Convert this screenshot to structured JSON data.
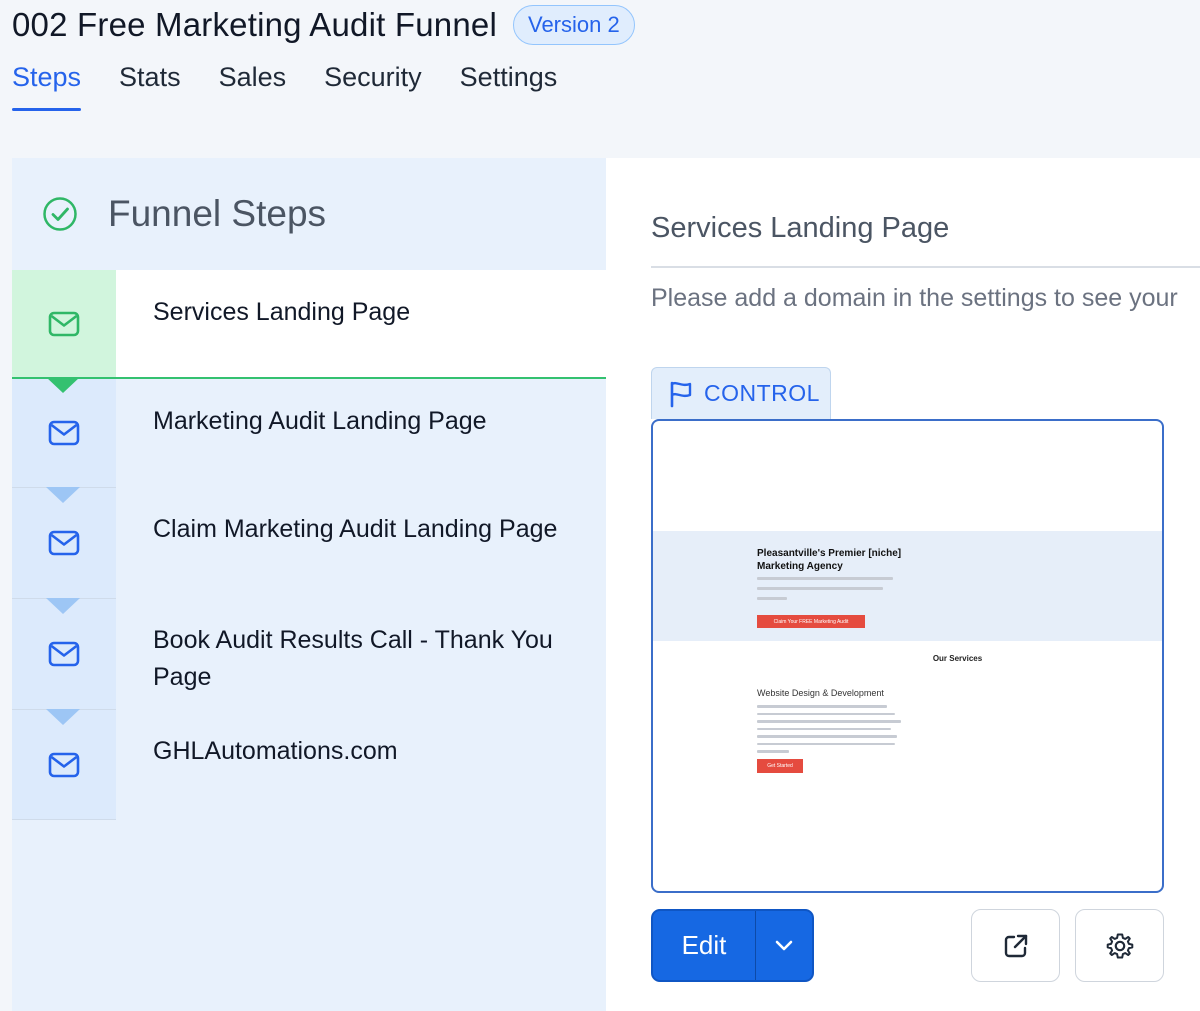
{
  "header": {
    "title": "002 Free Marketing Audit Funnel",
    "version_badge": "Version 2"
  },
  "tabs": [
    {
      "label": "Steps",
      "active": true
    },
    {
      "label": "Stats",
      "active": false
    },
    {
      "label": "Sales",
      "active": false
    },
    {
      "label": "Security",
      "active": false
    },
    {
      "label": "Settings",
      "active": false
    }
  ],
  "funnel_steps": {
    "title": "Funnel Steps",
    "header_icon": "check-circle-icon",
    "step_icon": "mail-icon",
    "items": [
      {
        "label": "Services Landing Page",
        "active": true
      },
      {
        "label": "Marketing Audit Landing Page",
        "active": false
      },
      {
        "label": "Claim Marketing Audit Landing Page",
        "active": false
      },
      {
        "label": "Book Audit Results Call - Thank You Page",
        "active": false
      },
      {
        "label": "GHLAutomations.com",
        "active": false
      }
    ]
  },
  "detail": {
    "title": "Services Landing Page",
    "notice": "Please add a domain in the settings to see your",
    "variant_tag": "CONTROL",
    "preview": {
      "hero_title": "Pleasantville's Premier [niche] Marketing Agency",
      "hero_button": "Claim Your FREE Marketing Audit",
      "services_heading": "Our Services",
      "service_title": "Website Design & Development",
      "service_button": "Get Started"
    },
    "edit_label": "Edit"
  },
  "colors": {
    "accent": "#2563eb",
    "primary_button": "#1668e3",
    "success": "#34c170",
    "panel_bg": "#e8f1fc"
  }
}
